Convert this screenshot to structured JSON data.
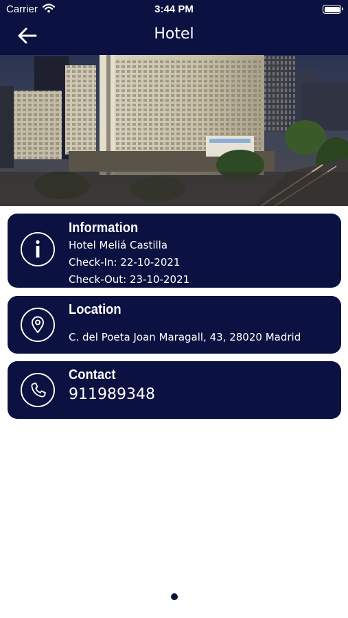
{
  "status_bar": {
    "carrier": "Carrier",
    "time": "3:44 PM"
  },
  "header": {
    "title": "Hotel",
    "back_icon": "arrow-left-icon",
    "background": "#0b1140"
  },
  "hero": {
    "image": "hotel-exterior-night-photo"
  },
  "cards": {
    "information": {
      "icon": "info-icon",
      "title": "Information",
      "hotel_name": "Hotel Meliá Castilla",
      "check_in": "Check-In: 22-10-2021",
      "check_out": "Check-Out: 23-10-2021"
    },
    "location": {
      "icon": "location-pin-icon",
      "title": "Location",
      "address": "C. del Poeta Joan Maragall, 43, 28020 Madrid"
    },
    "contact": {
      "icon": "phone-icon",
      "title": "Contact",
      "phone": "911989348"
    }
  },
  "pager": {
    "current_page": 1
  },
  "colors": {
    "primary": "#0b1140",
    "text_on_primary": "#ffffff",
    "background": "#ffffff"
  }
}
